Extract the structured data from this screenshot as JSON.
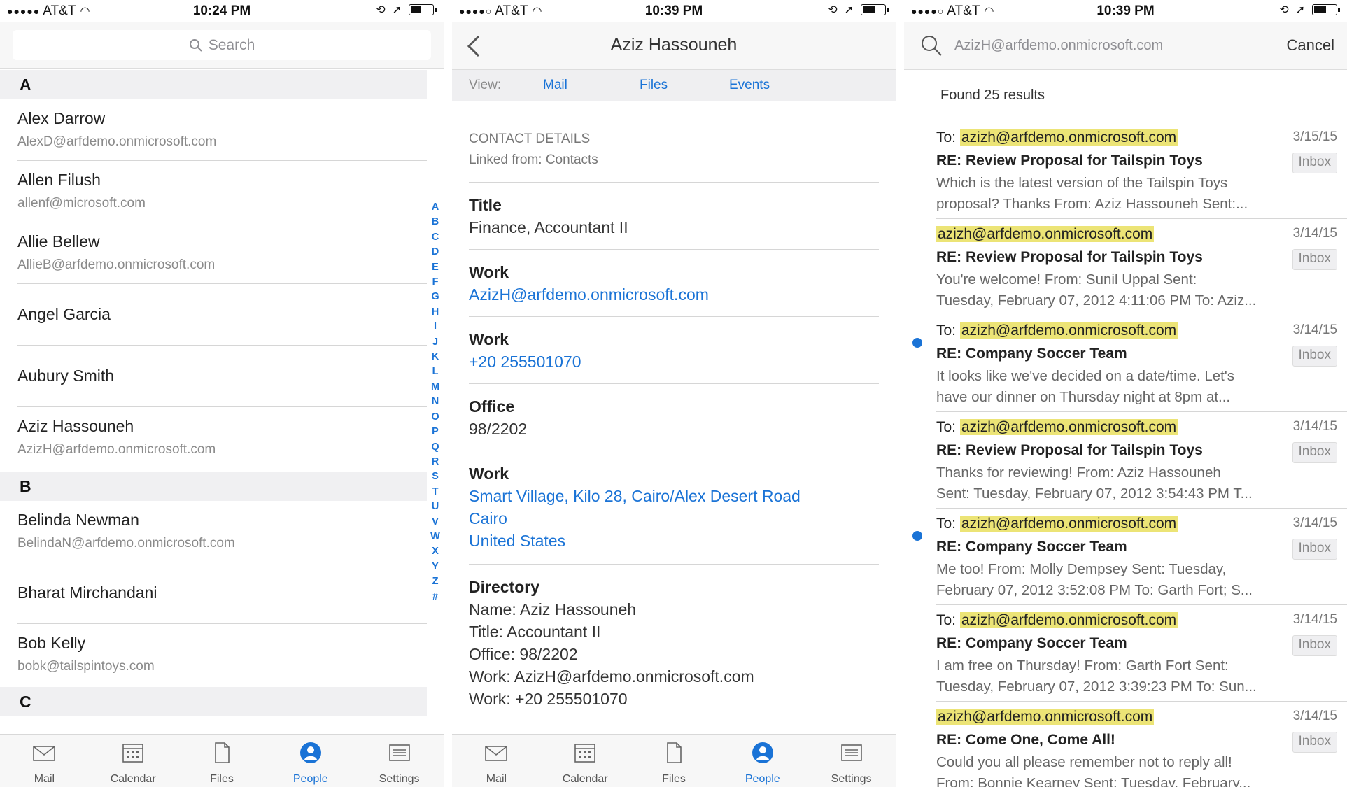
{
  "screen1": {
    "status": {
      "carrier": "AT&T",
      "time": "10:24 PM"
    },
    "search_placeholder": "Search",
    "sections": [
      "A",
      "B",
      "C"
    ],
    "people": [
      {
        "name": "Alex Darrow",
        "email": "AlexD@arfdemo.onmicrosoft.com"
      },
      {
        "name": "Allen Filush",
        "email": "allenf@microsoft.com"
      },
      {
        "name": "Allie Bellew",
        "email": "AllieB@arfdemo.onmicrosoft.com"
      },
      {
        "name": "Angel Garcia",
        "email": ""
      },
      {
        "name": "Aubury Smith",
        "email": ""
      },
      {
        "name": "Aziz Hassouneh",
        "email": "AzizH@arfdemo.onmicrosoft.com"
      },
      {
        "name": "Belinda Newman",
        "email": "BelindaN@arfdemo.onmicrosoft.com"
      },
      {
        "name": "Bharat Mirchandani",
        "email": ""
      },
      {
        "name": "Bob Kelly",
        "email": "bobk@tailspintoys.com"
      }
    ],
    "alpha_index": "A\nB\nC\nD\nE\nF\nG\nH\nI\nJ\nK\nL\nM\nN\nO\nP\nQ\nR\nS\nT\nU\nV\nW\nX\nY\nZ\n#",
    "active_tab": "People"
  },
  "tabs": {
    "mail": "Mail",
    "calendar": "Calendar",
    "files": "Files",
    "people": "People",
    "settings": "Settings"
  },
  "screen2": {
    "status": {
      "carrier": "AT&T",
      "time": "10:39 PM"
    },
    "title": "Aziz Hassouneh",
    "view_label": "View:",
    "view_tabs": [
      "Mail",
      "Files",
      "Events"
    ],
    "contact_details": "CONTACT DETAILS",
    "linked_from": "Linked from: Contacts",
    "title_label": "Title",
    "title_value": "Finance, Accountant II",
    "work_email_label": "Work",
    "work_email": "AzizH@arfdemo.onmicrosoft.com",
    "work_phone_label": "Work",
    "work_phone": "+20 255501070",
    "office_label": "Office",
    "office_value": "98/2202",
    "address_label": "Work",
    "address_line1": "Smart Village, Kilo 28, Cairo/Alex Desert Road",
    "address_line2": "Cairo",
    "address_line3": "United States",
    "directory_label": "Directory",
    "directory_lines": [
      "Name: Aziz Hassouneh",
      "Title: Accountant II",
      "Office: 98/2202",
      "Work: AzizH@arfdemo.onmicrosoft.com",
      "Work: +20 255501070"
    ]
  },
  "screen3": {
    "status": {
      "carrier": "AT&T",
      "time": "10:39 PM"
    },
    "query": "AzizH@arfdemo.onmicrosoft.com",
    "cancel": "Cancel",
    "found": "Found 25 results",
    "messages": [
      {
        "prefix": "To: ",
        "address": "azizh@arfdemo.onmicrosoft.com",
        "subject": "RE: Review Proposal for Tailspin Toys",
        "preview1": "Which is the latest version of the Tailspin Toys",
        "preview2": "proposal? Thanks From: Aziz Hassouneh Sent:...",
        "date": "3/15/15",
        "folder": "Inbox",
        "unread": false
      },
      {
        "prefix": "",
        "address": "azizh@arfdemo.onmicrosoft.com",
        "subject": "RE: Review Proposal for Tailspin Toys",
        "preview1": "You're welcome! From: Sunil Uppal Sent:",
        "preview2": "Tuesday, February 07, 2012 4:11:06 PM To: Aziz...",
        "date": "3/14/15",
        "folder": "Inbox",
        "unread": false
      },
      {
        "prefix": "To: ",
        "address": "azizh@arfdemo.onmicrosoft.com",
        "subject": "RE: Company Soccer Team",
        "preview1": "It looks like we've decided on a date/time. Let's",
        "preview2": "have our dinner on Thursday night at 8pm at...",
        "date": "3/14/15",
        "folder": "Inbox",
        "unread": true
      },
      {
        "prefix": "To: ",
        "address": "azizh@arfdemo.onmicrosoft.com",
        "subject": "RE: Review Proposal for Tailspin Toys",
        "preview1": "Thanks for reviewing! From: Aziz Hassouneh",
        "preview2": "Sent: Tuesday, February 07, 2012 3:54:43 PM T...",
        "date": "3/14/15",
        "folder": "Inbox",
        "unread": false
      },
      {
        "prefix": "To: ",
        "address": "azizh@arfdemo.onmicrosoft.com",
        "subject": "RE: Company Soccer Team",
        "preview1": "Me too! From: Molly Dempsey Sent: Tuesday,",
        "preview2": "February 07, 2012 3:52:08 PM To: Garth Fort; S...",
        "date": "3/14/15",
        "folder": "Inbox",
        "unread": true
      },
      {
        "prefix": "To: ",
        "address": "azizh@arfdemo.onmicrosoft.com",
        "subject": "RE: Company Soccer Team",
        "preview1": "I am free on Thursday! From: Garth Fort Sent:",
        "preview2": "Tuesday, February 07, 2012 3:39:23 PM To: Sun...",
        "date": "3/14/15",
        "folder": "Inbox",
        "unread": false
      },
      {
        "prefix": "",
        "address": "azizh@arfdemo.onmicrosoft.com",
        "subject": "RE: Come One, Come All!",
        "preview1": "Could you all please remember not to reply all!",
        "preview2": "From: Bonnie Kearney Sent: Tuesday, February...",
        "date": "3/14/15",
        "folder": "Inbox",
        "unread": false
      }
    ]
  },
  "colors": {
    "accent": "#1a73d6",
    "highlight": "#ece476",
    "bar_bg": "#f7f7f7"
  },
  "icons": [
    "search-icon",
    "back-chevron-icon",
    "mail-icon",
    "calendar-icon",
    "files-icon",
    "people-icon",
    "settings-icon",
    "wifi-icon",
    "location-icon",
    "rotation-lock-icon",
    "battery-icon"
  ]
}
